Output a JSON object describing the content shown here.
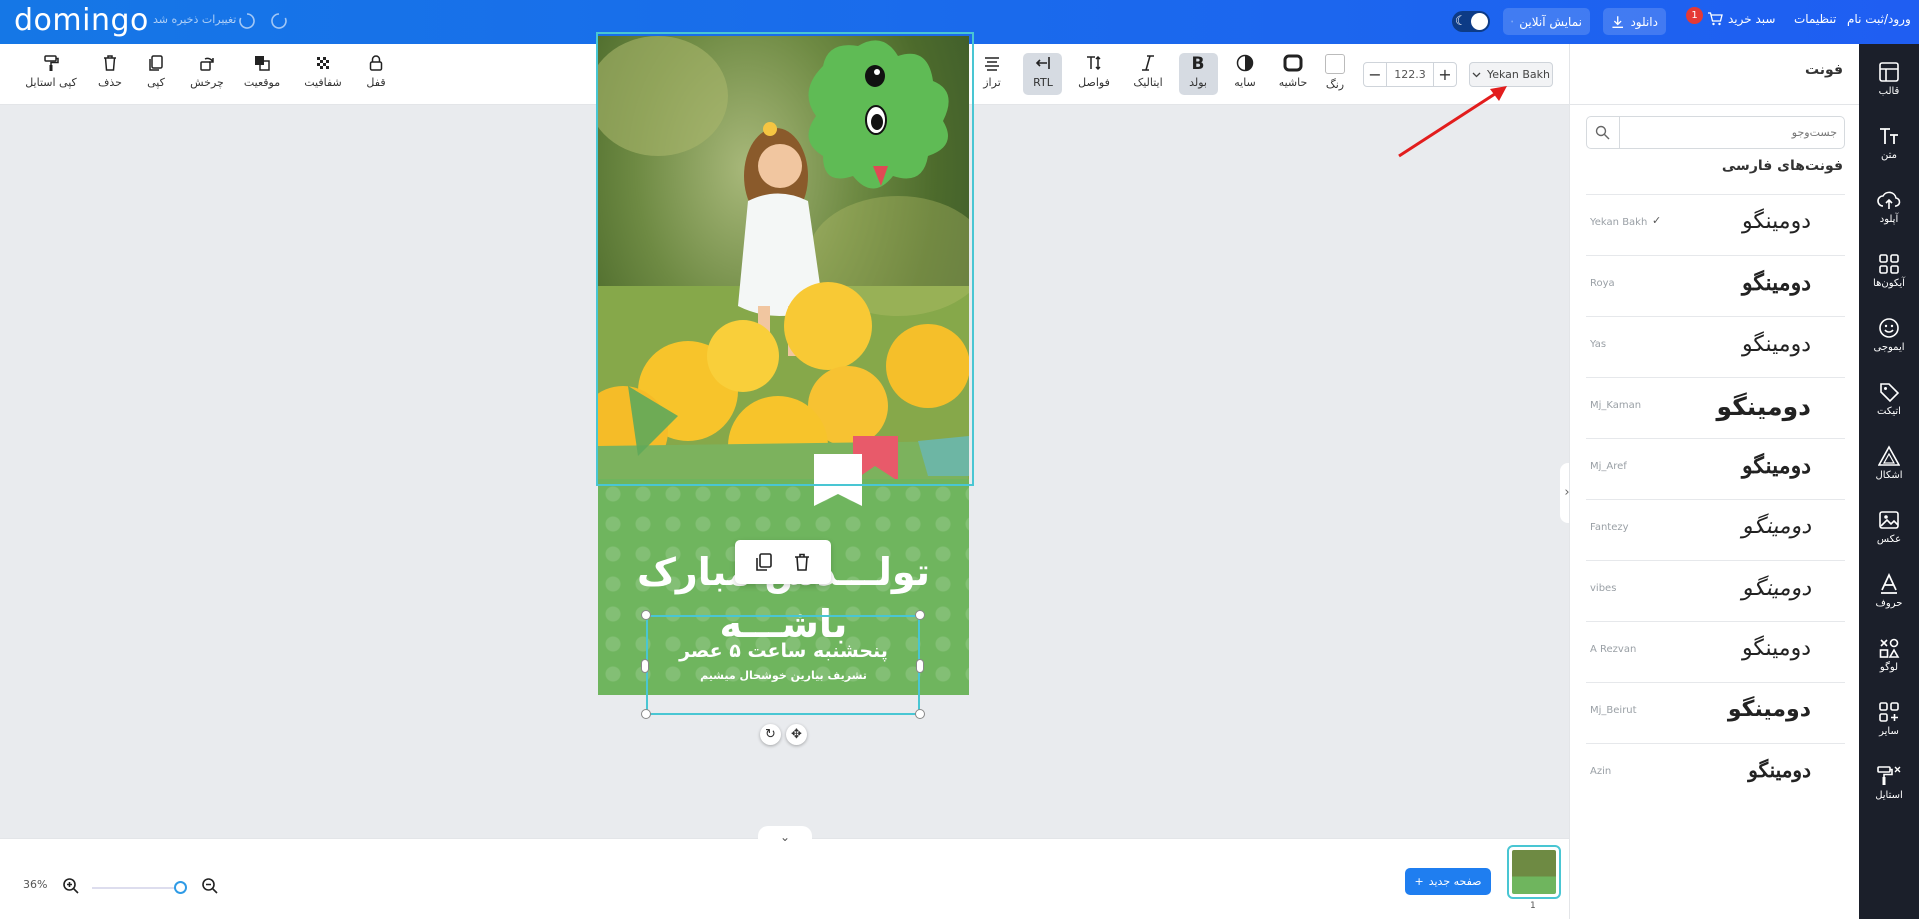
{
  "topbar": {
    "logo": "domingo",
    "saved_status": "تغییرات ذخیره شد",
    "preview_online": "نمایش آنلاین",
    "download": "دانلود",
    "cart": "سبد خرید",
    "cart_count": "1",
    "settings": "تنظیمات",
    "login": "ورود/ثبت نام"
  },
  "toolbar": {
    "copy_style": "کپی استایل",
    "delete": "حذف",
    "copy": "کپی",
    "rotate": "چرخش",
    "position": "موقعیت",
    "opacity": "شفافیت",
    "lock": "قفل",
    "align": "تراز",
    "rtl": "RTL",
    "spacing": "فواصل",
    "italic": "ایتالیک",
    "bold": "بولد",
    "shadow": "سایه",
    "border": "حاشیه",
    "color": "رنگ",
    "font_size": "122.3",
    "font_name": "Yekan Bakh"
  },
  "design": {
    "heading": "تولـــدش مبارک باشـــه",
    "date_line": "پنحشنبه ساعت ۵ عصر",
    "invite_line": "تشریف بیارین خوشحال میشیم"
  },
  "bottom": {
    "zoom": "36%",
    "new_page": "صفحه جدید",
    "page_number": "1"
  },
  "panel": {
    "title": "فونت",
    "search_placeholder": "جست‌وجو",
    "section": "فونت‌های فارسی",
    "preview_word": "دومینگو",
    "fonts": [
      {
        "name": "Yekan Bakh",
        "selected": "✓"
      },
      {
        "name": "Roya",
        "selected": ""
      },
      {
        "name": "Yas",
        "selected": ""
      },
      {
        "name": "Mj_Kaman",
        "selected": ""
      },
      {
        "name": "Mj_Aref",
        "selected": ""
      },
      {
        "name": "Fantezy",
        "selected": ""
      },
      {
        "name": "vibes",
        "selected": ""
      },
      {
        "name": "A Rezvan",
        "selected": ""
      },
      {
        "name": "Mj_Beirut",
        "selected": ""
      },
      {
        "name": "Azin",
        "selected": ""
      }
    ]
  },
  "sidebar": {
    "items": [
      "قالب",
      "متن",
      "آپلود",
      "آیکون‌ها",
      "ایموجی",
      "اتیکت",
      "اشکال",
      "عکس",
      "حروف",
      "لوگو",
      "سایر",
      "استایل"
    ]
  },
  "colors": {
    "topbar": "#1f5ef2",
    "sidebar": "#1b1f2a",
    "design_bg": "#6fb55e",
    "selection": "#49c6d3",
    "annotation_arrow": "#e21d1d"
  }
}
